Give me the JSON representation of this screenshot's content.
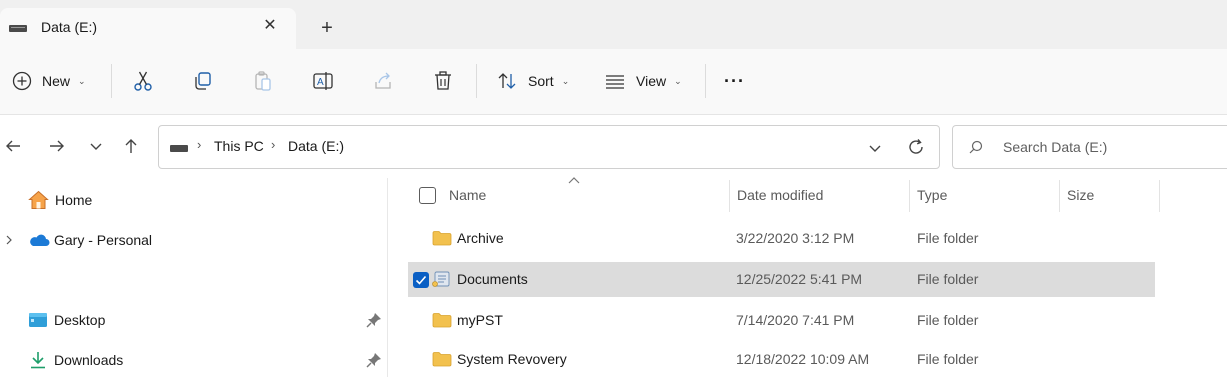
{
  "tab": {
    "title": "Data (E:)",
    "close_glyph": "✕",
    "new_tab_glyph": "+"
  },
  "toolbar": {
    "new_label": "New",
    "sort_label": "Sort",
    "view_label": "View",
    "caret": "⌄",
    "more_glyph": "···",
    "icons": [
      "new-icon",
      "cut-icon",
      "copy-icon",
      "paste-icon",
      "rename-icon",
      "share-icon",
      "delete-icon",
      "sort-icon",
      "view-icon",
      "more-icon"
    ]
  },
  "address": {
    "breadcrumbs": [
      "This PC",
      "Data (E:)"
    ],
    "separator": "›"
  },
  "search": {
    "placeholder": "Search Data (E:)"
  },
  "navpane": {
    "items": [
      {
        "label": "Home",
        "icon": "home-icon"
      },
      {
        "label": "Gary - Personal",
        "icon": "onedrive-cloud-icon"
      },
      {
        "label": "Desktop",
        "icon": "desktop-folder-icon",
        "pinned": true
      },
      {
        "label": "Downloads",
        "icon": "downloads-icon",
        "pinned": true
      }
    ]
  },
  "filelist": {
    "columns": [
      "Name",
      "Date modified",
      "Type",
      "Size"
    ],
    "rows": [
      {
        "name": "Archive",
        "date": "3/22/2020 3:12 PM",
        "type": "File folder",
        "selected": false
      },
      {
        "name": "Documents",
        "date": "12/25/2022 5:41 PM",
        "type": "File folder",
        "selected": true
      },
      {
        "name": "myPST",
        "date": "7/14/2020 7:41 PM",
        "type": "File folder",
        "selected": false
      },
      {
        "name": "System Revovery",
        "date": "12/18/2022 10:09 AM",
        "type": "File folder",
        "selected": false
      }
    ]
  },
  "colors": {
    "accent": "#0a5fc4",
    "folder": "#f2c14e",
    "selected_row": "#dcdcdc"
  }
}
